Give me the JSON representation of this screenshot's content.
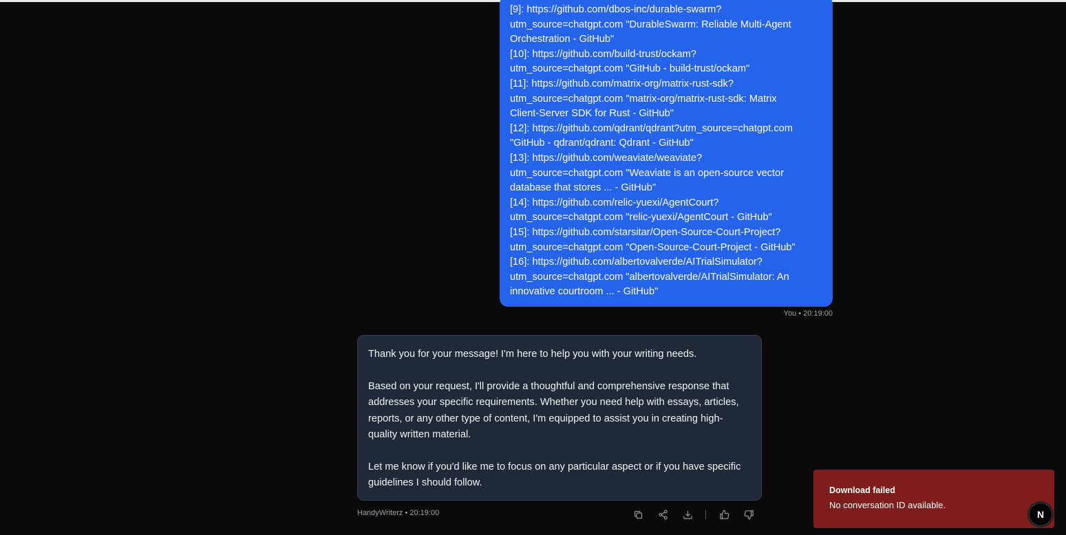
{
  "user_message": {
    "lines": [
      "[9]: https://github.com/dbos-inc/durable-swarm?",
      "utm_source=chatgpt.com \"DurableSwarm: Reliable Multi-Agent",
      "Orchestration - GitHub\"",
      "[10]: https://github.com/build-trust/ockam?",
      "utm_source=chatgpt.com \"GitHub - build-trust/ockam\"",
      "[11]: https://github.com/matrix-org/matrix-rust-sdk?",
      "utm_source=chatgpt.com \"matrix-org/matrix-rust-sdk: Matrix",
      "Client-Server SDK for Rust - GitHub\"",
      "[12]: https://github.com/qdrant/qdrant?utm_source=chatgpt.com",
      "\"GitHub - qdrant/qdrant: Qdrant - GitHub\"",
      "[13]: https://github.com/weaviate/weaviate?",
      "utm_source=chatgpt.com \"Weaviate is an open-source vector",
      "database that stores ... - GitHub\"",
      "[14]: https://github.com/relic-yuexi/AgentCourt?",
      "utm_source=chatgpt.com \"relic-yuexi/AgentCourt - GitHub\"",
      "[15]: https://github.com/starsitar/Open-Source-Court-Project?",
      "utm_source=chatgpt.com \"Open-Source-Court-Project - GitHub\"",
      "[16]: https://github.com/albertovalverde/AITrialSimulator?",
      "utm_source=chatgpt.com \"albertovalverde/AITrialSimulator: An",
      "innovative courtroom ... - GitHub\""
    ],
    "meta": "You • 20:19:00"
  },
  "bot_message": {
    "paragraphs": [
      "Thank you for your message! I'm here to help you with your writing needs.",
      "Based on your request, I'll provide a thoughtful and comprehensive response that addresses your specific requirements. Whether you need help with essays, articles, reports, or any other type of content, I'm equipped to assist you in creating high-quality written material.",
      "Let me know if you'd like me to focus on any particular aspect or if you have specific guidelines I should follow."
    ],
    "meta": "HandyWriterz • 20:19:00",
    "actions": [
      "copy-icon",
      "share-icon",
      "download-icon",
      "thumbs-up-icon",
      "thumbs-down-icon"
    ]
  },
  "toast": {
    "title": "Download failed",
    "description": "No conversation ID available."
  },
  "dev_badge": {
    "letter": "N"
  },
  "colors": {
    "user_bubble": "#2563eb",
    "bot_bubble": "#1f2937",
    "toast": "#7f1d1d",
    "background": "#0a0a0a"
  }
}
